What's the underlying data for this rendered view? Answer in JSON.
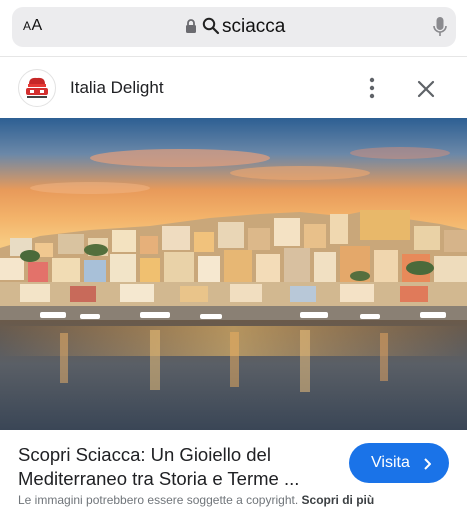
{
  "address_bar": {
    "text_size_label": "AA",
    "query": "sciacca",
    "icons": [
      "lock-icon",
      "search-icon",
      "microphone-icon"
    ]
  },
  "source": {
    "name": "Italia Delight",
    "logo": "italia-delight-logo",
    "icons": [
      "more-vertical-icon",
      "close-icon"
    ]
  },
  "image": {
    "subject": "Sciacca",
    "lens_icon": "image-search-icon"
  },
  "result": {
    "title_line1": "Scopri Sciacca: Un Gioiello del",
    "title_line2": "Mediterraneo tra Storia e Terme ...",
    "visit_label": "Visita",
    "copyright_notice": "Le immagini potrebbero essere soggette a copyright.",
    "learn_more_link": "Scopri di più"
  },
  "colors": {
    "accent": "#1a73e8",
    "urlbar_bg": "#ececee"
  }
}
